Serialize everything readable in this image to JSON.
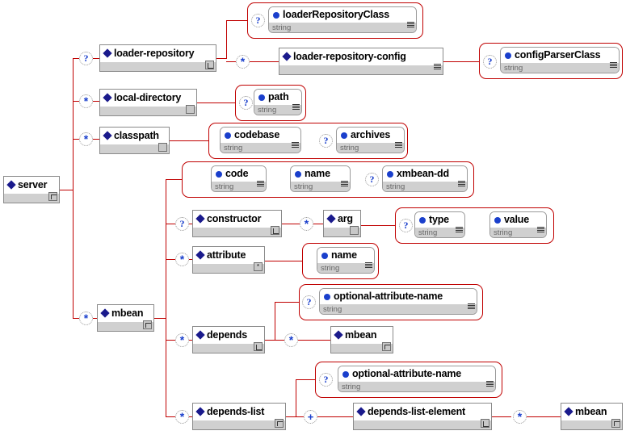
{
  "diagram": {
    "title": "JBoss server XML schema tree",
    "type": "xsd-tree",
    "colors": {
      "connector": "#c00000",
      "element_fill": "#ffffff",
      "element_footer": "#d0d0d0",
      "element_border": "#8a8a8a",
      "attribute_border": "#9a9a9a",
      "attribute_group_border": "#c00000",
      "element_marker": "#1a1a8c",
      "attribute_marker": "#1a3fcc",
      "occurrence_marker": "#1a3fcc",
      "type_text": "#666666",
      "background": "#ffffff"
    }
  },
  "nodes": {
    "server": {
      "label": "server",
      "kind": "element",
      "badge": "loop"
    },
    "loader_repository": {
      "label": "loader-repository",
      "kind": "element",
      "badge": "seq",
      "occurrence": "?"
    },
    "loader_repository_class": {
      "label": "loaderRepositoryClass",
      "kind": "attribute",
      "type": "string",
      "occurrence": "?"
    },
    "loader_repository_config": {
      "label": "loader-repository-config",
      "kind": "element",
      "badge": "lines",
      "occurrence": "*"
    },
    "config_parser_class": {
      "label": "configParserClass",
      "kind": "attribute",
      "type": "string",
      "occurrence": "?"
    },
    "local_directory": {
      "label": "local-directory",
      "kind": "element",
      "badge": "plain",
      "occurrence": "*"
    },
    "path": {
      "label": "path",
      "kind": "attribute",
      "type": "string",
      "occurrence": "?"
    },
    "classpath": {
      "label": "classpath",
      "kind": "element",
      "badge": "plain",
      "occurrence": "*"
    },
    "codebase": {
      "label": "codebase",
      "kind": "attribute",
      "type": "string",
      "occurrence": ""
    },
    "archives": {
      "label": "archives",
      "kind": "attribute",
      "type": "string",
      "occurrence": "?"
    },
    "mbean": {
      "label": "mbean",
      "kind": "element",
      "badge": "loop",
      "occurrence": "*"
    },
    "code": {
      "label": "code",
      "kind": "attribute",
      "type": "string",
      "occurrence": ""
    },
    "name_mbean": {
      "label": "name",
      "kind": "attribute",
      "type": "string",
      "occurrence": ""
    },
    "xmbean_dd": {
      "label": "xmbean-dd",
      "kind": "attribute",
      "type": "string",
      "occurrence": "?"
    },
    "constructor": {
      "label": "constructor",
      "kind": "element",
      "badge": "seq",
      "occurrence": "?"
    },
    "arg": {
      "label": "arg",
      "kind": "element",
      "badge": "plain",
      "occurrence": "*"
    },
    "type": {
      "label": "type",
      "kind": "attribute",
      "type": "string",
      "occurrence": "?"
    },
    "value": {
      "label": "value",
      "kind": "attribute",
      "type": "string",
      "occurrence": ""
    },
    "attribute": {
      "label": "attribute",
      "kind": "element",
      "badge": "ast",
      "occurrence": "*"
    },
    "name_attribute": {
      "label": "name",
      "kind": "attribute",
      "type": "string",
      "occurrence": ""
    },
    "depends": {
      "label": "depends",
      "kind": "element",
      "badge": "seq",
      "occurrence": "*"
    },
    "depends_oan": {
      "label": "optional-attribute-name",
      "kind": "attribute",
      "type": "string",
      "occurrence": "?"
    },
    "depends_mbean": {
      "label": "mbean",
      "kind": "element",
      "badge": "loop",
      "occurrence": "*"
    },
    "depends_list": {
      "label": "depends-list",
      "kind": "element",
      "badge": "loop",
      "occurrence": "*"
    },
    "depends_list_oan": {
      "label": "optional-attribute-name",
      "kind": "attribute",
      "type": "string",
      "occurrence": "?"
    },
    "depends_list_element": {
      "label": "depends-list-element",
      "kind": "element",
      "badge": "seq",
      "occurrence": "+"
    },
    "depends_list_element_mbean": {
      "label": "mbean",
      "kind": "element",
      "badge": "loop",
      "occurrence": "*"
    }
  },
  "occurrence_legend": {
    "optional": "?",
    "zero_or_more": "*",
    "one_or_more": "+"
  }
}
